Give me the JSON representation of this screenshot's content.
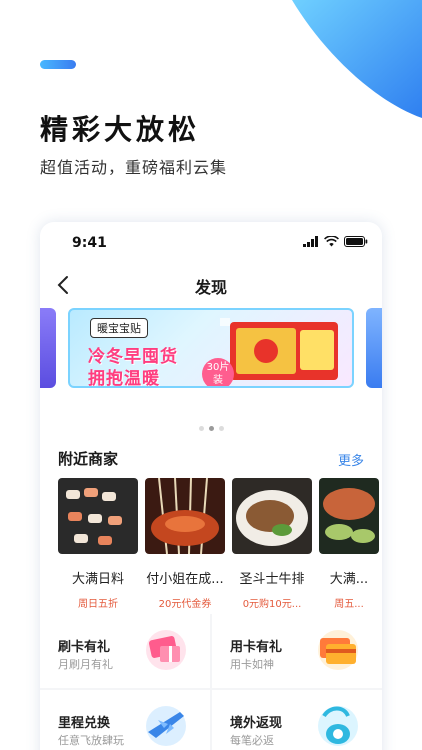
{
  "hero": {
    "headline": "精彩大放松",
    "subline": "超值活动，重磅福利云集"
  },
  "status_bar": {
    "time": "9:41"
  },
  "nav": {
    "title": "发现"
  },
  "banner": {
    "tag": "暖宝宝贴",
    "line1": "冷冬早囤货",
    "line2": "拥抱温暖",
    "badge_line1": "30片",
    "badge_line2": "装"
  },
  "nearby": {
    "title": "附近商家",
    "more": "更多",
    "merchants": [
      {
        "name": "大满日料",
        "promo": "周日五折"
      },
      {
        "name": "付小姐在成...",
        "promo": "20元代金券"
      },
      {
        "name": "圣斗士牛排",
        "promo": "0元购10元..."
      },
      {
        "name": "大满...",
        "promo": "周五..."
      }
    ]
  },
  "services": [
    {
      "title": "刷卡有礼",
      "sub": "月刷月有礼"
    },
    {
      "title": "用卡有礼",
      "sub": "用卡如神"
    },
    {
      "title": "里程兑换",
      "sub": "任意飞放肆玩"
    },
    {
      "title": "境外返现",
      "sub": "每笔必返"
    }
  ],
  "colors": {
    "accent": "#3a86e8",
    "promo": "#e45a3c",
    "brand_blue": "#3a7cf0"
  }
}
